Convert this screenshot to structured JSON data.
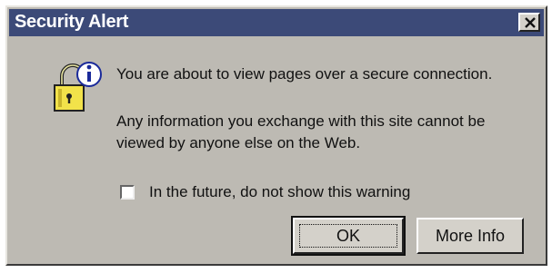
{
  "window": {
    "title": "Security Alert"
  },
  "message": {
    "line1": "You are about to view pages over a secure connection.",
    "line2": "Any information you exchange with this site cannot be viewed by anyone else on the Web."
  },
  "checkbox": {
    "label": "In the future, do not show this warning",
    "checked": false
  },
  "buttons": {
    "ok_label": "OK",
    "more_info_label": "More Info"
  },
  "icons": {
    "dialog_icon": "padlock-info-icon",
    "close": "close-icon"
  },
  "colors": {
    "titlebar": "#3c4a78",
    "dialog_bg": "#bdbab3",
    "button_face": "#d4d1ca"
  }
}
